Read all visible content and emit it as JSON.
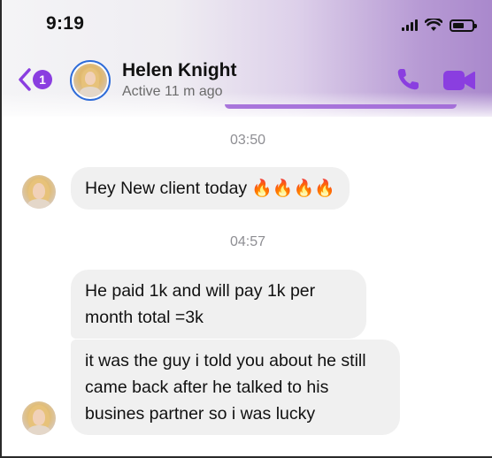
{
  "status_bar": {
    "time": "9:19"
  },
  "header": {
    "back_badge_count": "1",
    "contact_name": "Helen Knight",
    "contact_status": "Active 11 m ago"
  },
  "icons": {
    "back": "chevron-left-icon",
    "call": "phone-icon",
    "video": "video-camera-icon",
    "fire": "fire-emoji"
  },
  "colors": {
    "accent": "#8a3ee0",
    "bubble": "#f0f0f0",
    "avatar_ring": "#2f6cd8"
  },
  "messages": [
    {
      "timestamp": "03:50",
      "text": "Hey New client today",
      "emoji": "🔥🔥🔥🔥"
    },
    {
      "timestamp": "04:57",
      "text": "He paid 1k and will pay 1k per month total =3k"
    },
    {
      "text": "it was the guy i told you about he still came back after he talked to his busines partner so i was lucky"
    }
  ]
}
